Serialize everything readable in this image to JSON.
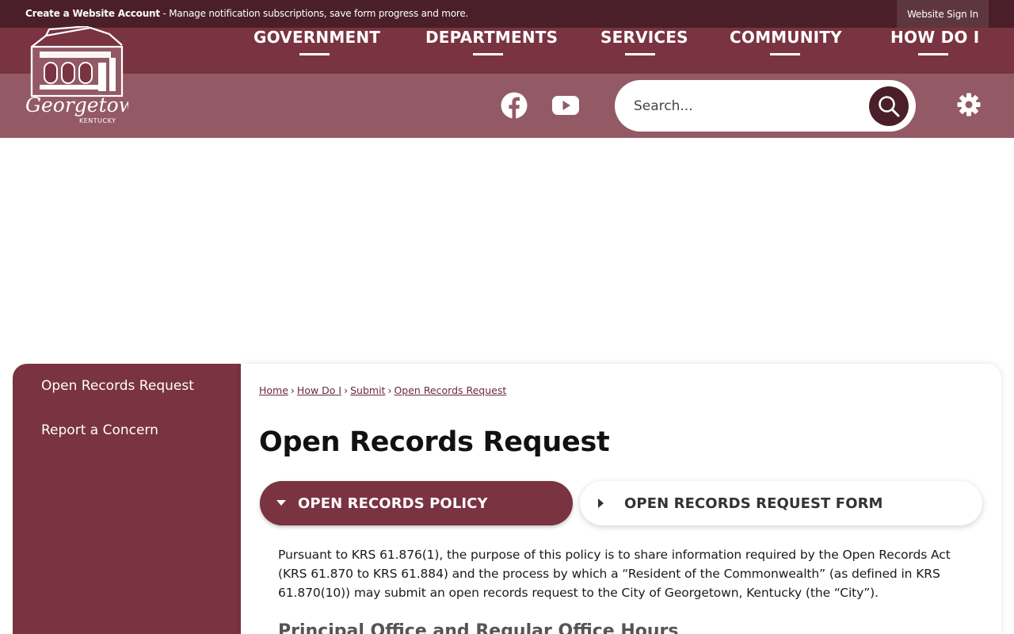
{
  "utility_bar": {
    "account_link": "Create a Website Account",
    "message": " - Manage notification subscriptions, save form progress and more.",
    "sign_in": "Website Sign In"
  },
  "logo": {
    "name": "Georgetown",
    "state": "KENTUCKY"
  },
  "main_nav": {
    "items": [
      {
        "label": "GOVERNMENT"
      },
      {
        "label": "DEPARTMENTS"
      },
      {
        "label": "SERVICES"
      },
      {
        "label": "COMMUNITY"
      },
      {
        "label": "HOW DO I"
      }
    ]
  },
  "icons": {
    "facebook": "facebook-icon",
    "youtube": "youtube-icon",
    "search": "search-icon",
    "settings": "gear-icon"
  },
  "search": {
    "placeholder": "Search..."
  },
  "sidebar": {
    "items": [
      {
        "label": "Open Records Request"
      },
      {
        "label": "Report a Concern"
      }
    ]
  },
  "breadcrumb": {
    "items": [
      "Home",
      "How Do I",
      "Submit",
      "Open Records Request"
    ],
    "separator": "›"
  },
  "page": {
    "title": "Open Records Request",
    "tabs": [
      {
        "label": "OPEN RECORDS POLICY",
        "state": "expanded"
      },
      {
        "label": "OPEN RECORDS REQUEST FORM",
        "state": "collapsed"
      }
    ],
    "body": "Pursuant to KRS 61.876(1), the purpose of this policy is to share information required by the Open Records Act (KRS 61.870 to KRS 61.884) and the process by which a “Resident of the Commonwealth” (as defined in KRS 61.870(10)) may submit an open records request to the City of Georgetown, Kentucky (the “City”).",
    "subheading": "Principal Office and Regular Office Hours"
  },
  "colors": {
    "brand_dark": "#4a1f2a",
    "brand": "#7a3340",
    "brand_light": "#935a66"
  }
}
